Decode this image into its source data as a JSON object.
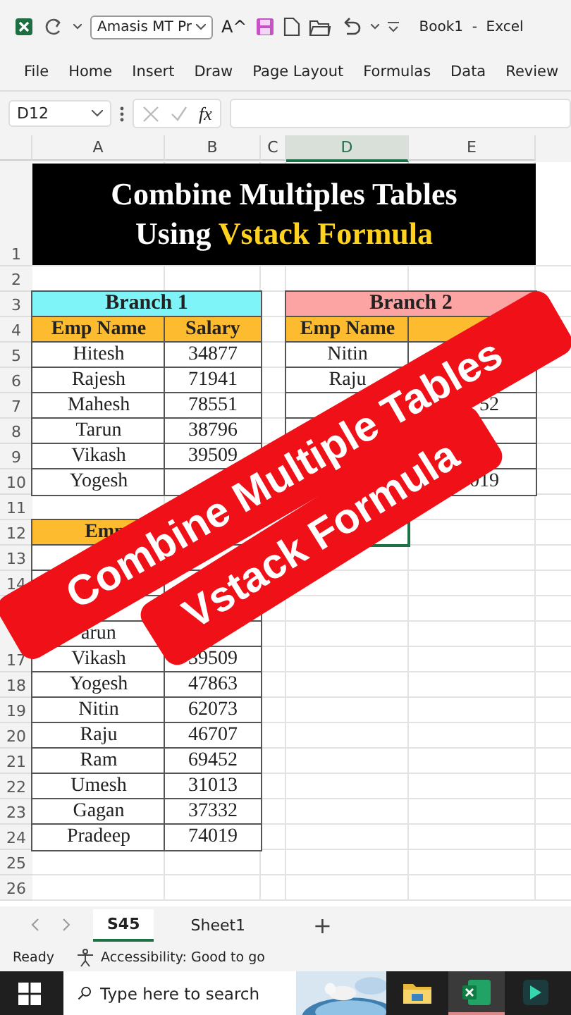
{
  "quick_access": {
    "font_box": "Amasis MT Pr",
    "grow_font": "A^",
    "title": "Book1  -  Excel"
  },
  "ribbon_tabs": [
    "File",
    "Home",
    "Insert",
    "Draw",
    "Page Layout",
    "Formulas",
    "Data",
    "Review"
  ],
  "formula_bar": {
    "name_box": "D12",
    "fx": "fx"
  },
  "columns": [
    {
      "label": "A",
      "selected": false
    },
    {
      "label": "B",
      "selected": false
    },
    {
      "label": "C",
      "selected": false
    },
    {
      "label": "D",
      "selected": true
    },
    {
      "label": "E",
      "selected": false
    }
  ],
  "row_numbers": [
    "1",
    "2",
    "3",
    "4",
    "5",
    "6",
    "7",
    "8",
    "9",
    "10",
    "11",
    "12",
    "13",
    "14"
  ],
  "row_numbers_below": [
    "17",
    "18",
    "19",
    "20",
    "21",
    "22",
    "23",
    "24",
    "25",
    "26"
  ],
  "title_box": {
    "lines": [
      [
        {
          "text": "Combine Multiples Tables",
          "highlight": false
        }
      ],
      [
        {
          "text": "Using ",
          "highlight": false
        },
        {
          "text": "Vstack Formula",
          "highlight": true
        }
      ]
    ]
  },
  "branch1": {
    "title": "Branch 1",
    "color": "#7ff4f8",
    "headers": [
      "Emp Name",
      "Salary"
    ],
    "rows": [
      {
        "name": "Hitesh",
        "salary": "34877"
      },
      {
        "name": "Rajesh",
        "salary": "71941"
      },
      {
        "name": "Mahesh",
        "salary": "78551"
      },
      {
        "name": "Tarun",
        "salary": "38796"
      },
      {
        "name": "Vikash",
        "salary": "39509"
      },
      {
        "name": "Yogesh"
      }
    ]
  },
  "branch2": {
    "title": "Branch 2",
    "color": "#fca3a3",
    "headers": [
      "Emp Name"
    ],
    "rows": [
      {
        "name": "Nitin"
      },
      {
        "name": "Raju"
      },
      {
        "salary": "52"
      },
      {},
      {},
      {
        "salary": "019"
      }
    ]
  },
  "combined": {
    "headers": [
      "Emp"
    ],
    "rows": [
      {},
      {},
      {},
      {
        "name": "arun"
      },
      {
        "name": "Vikash",
        "salary": "39509"
      },
      {
        "name": "Yogesh",
        "salary": "47863"
      },
      {
        "name": "Nitin",
        "salary": "62073"
      },
      {
        "name": "Raju",
        "salary": "46707"
      },
      {
        "name": "Ram",
        "salary": "69452"
      },
      {
        "name": "Umesh",
        "salary": "31013"
      },
      {
        "name": "Gagan",
        "salary": "37332"
      },
      {
        "name": "Pradeep",
        "salary": "74019"
      }
    ]
  },
  "banner": {
    "lines": [
      "Combine Multiple Tables",
      "Vstack Formula"
    ]
  },
  "sheet_tabs": [
    {
      "label": "S45",
      "selected": true
    },
    {
      "label": "Sheet1",
      "selected": false
    }
  ],
  "add_sheet": "+",
  "status_bar": {
    "mode": "Ready",
    "accessibility": "Accessibility: Good to go"
  },
  "taskbar": {
    "search_placeholder": "Type here to search",
    "apps": [
      {
        "kind": "folder",
        "active": false
      },
      {
        "kind": "excel",
        "active": true
      },
      {
        "kind": "app",
        "active": false
      }
    ]
  }
}
